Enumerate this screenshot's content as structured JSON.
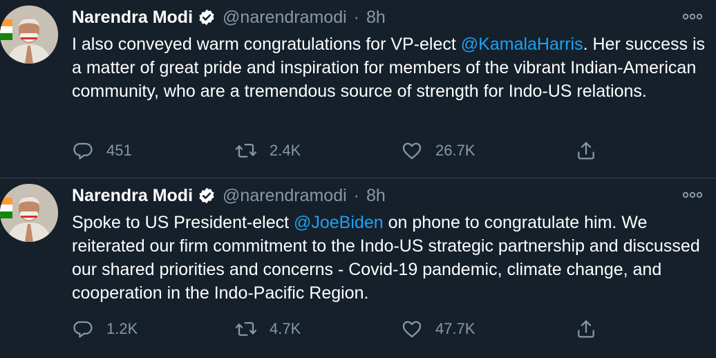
{
  "tweets": [
    {
      "author_name": "Narendra Modi",
      "handle": "@narendramodi",
      "separator": "·",
      "time": "8h",
      "text_before": "I also conveyed warm congratulations for VP-elect ",
      "mention": "@KamalaHarris",
      "text_after": ". Her success is a matter of great pride and inspiration for members of the vibrant Indian-American community, who are a tremendous source of strength for Indo-US relations.",
      "replies": "451",
      "retweets": "2.4K",
      "likes": "26.7K"
    },
    {
      "author_name": "Narendra Modi",
      "handle": "@narendramodi",
      "separator": "·",
      "time": "8h",
      "text_before": "Spoke to US President-elect ",
      "mention": "@JoeBiden",
      "text_after": " on phone to congratulate him. We reiterated our firm commitment to the Indo-US strategic partnership and discussed our shared priorities and concerns - Covid-19 pandemic, climate change, and cooperation in the Indo-Pacific Region.",
      "replies": "1.2K",
      "retweets": "4.7K",
      "likes": "47.7K"
    }
  ],
  "colors": {
    "background": "#15202b",
    "divider": "#38444d",
    "text": "#ffffff",
    "secondary": "#8899a6",
    "link": "#1da1f2"
  },
  "icons": [
    "verified-badge-icon",
    "more-options-icon",
    "reply-icon",
    "retweet-icon",
    "like-icon",
    "share-icon"
  ]
}
